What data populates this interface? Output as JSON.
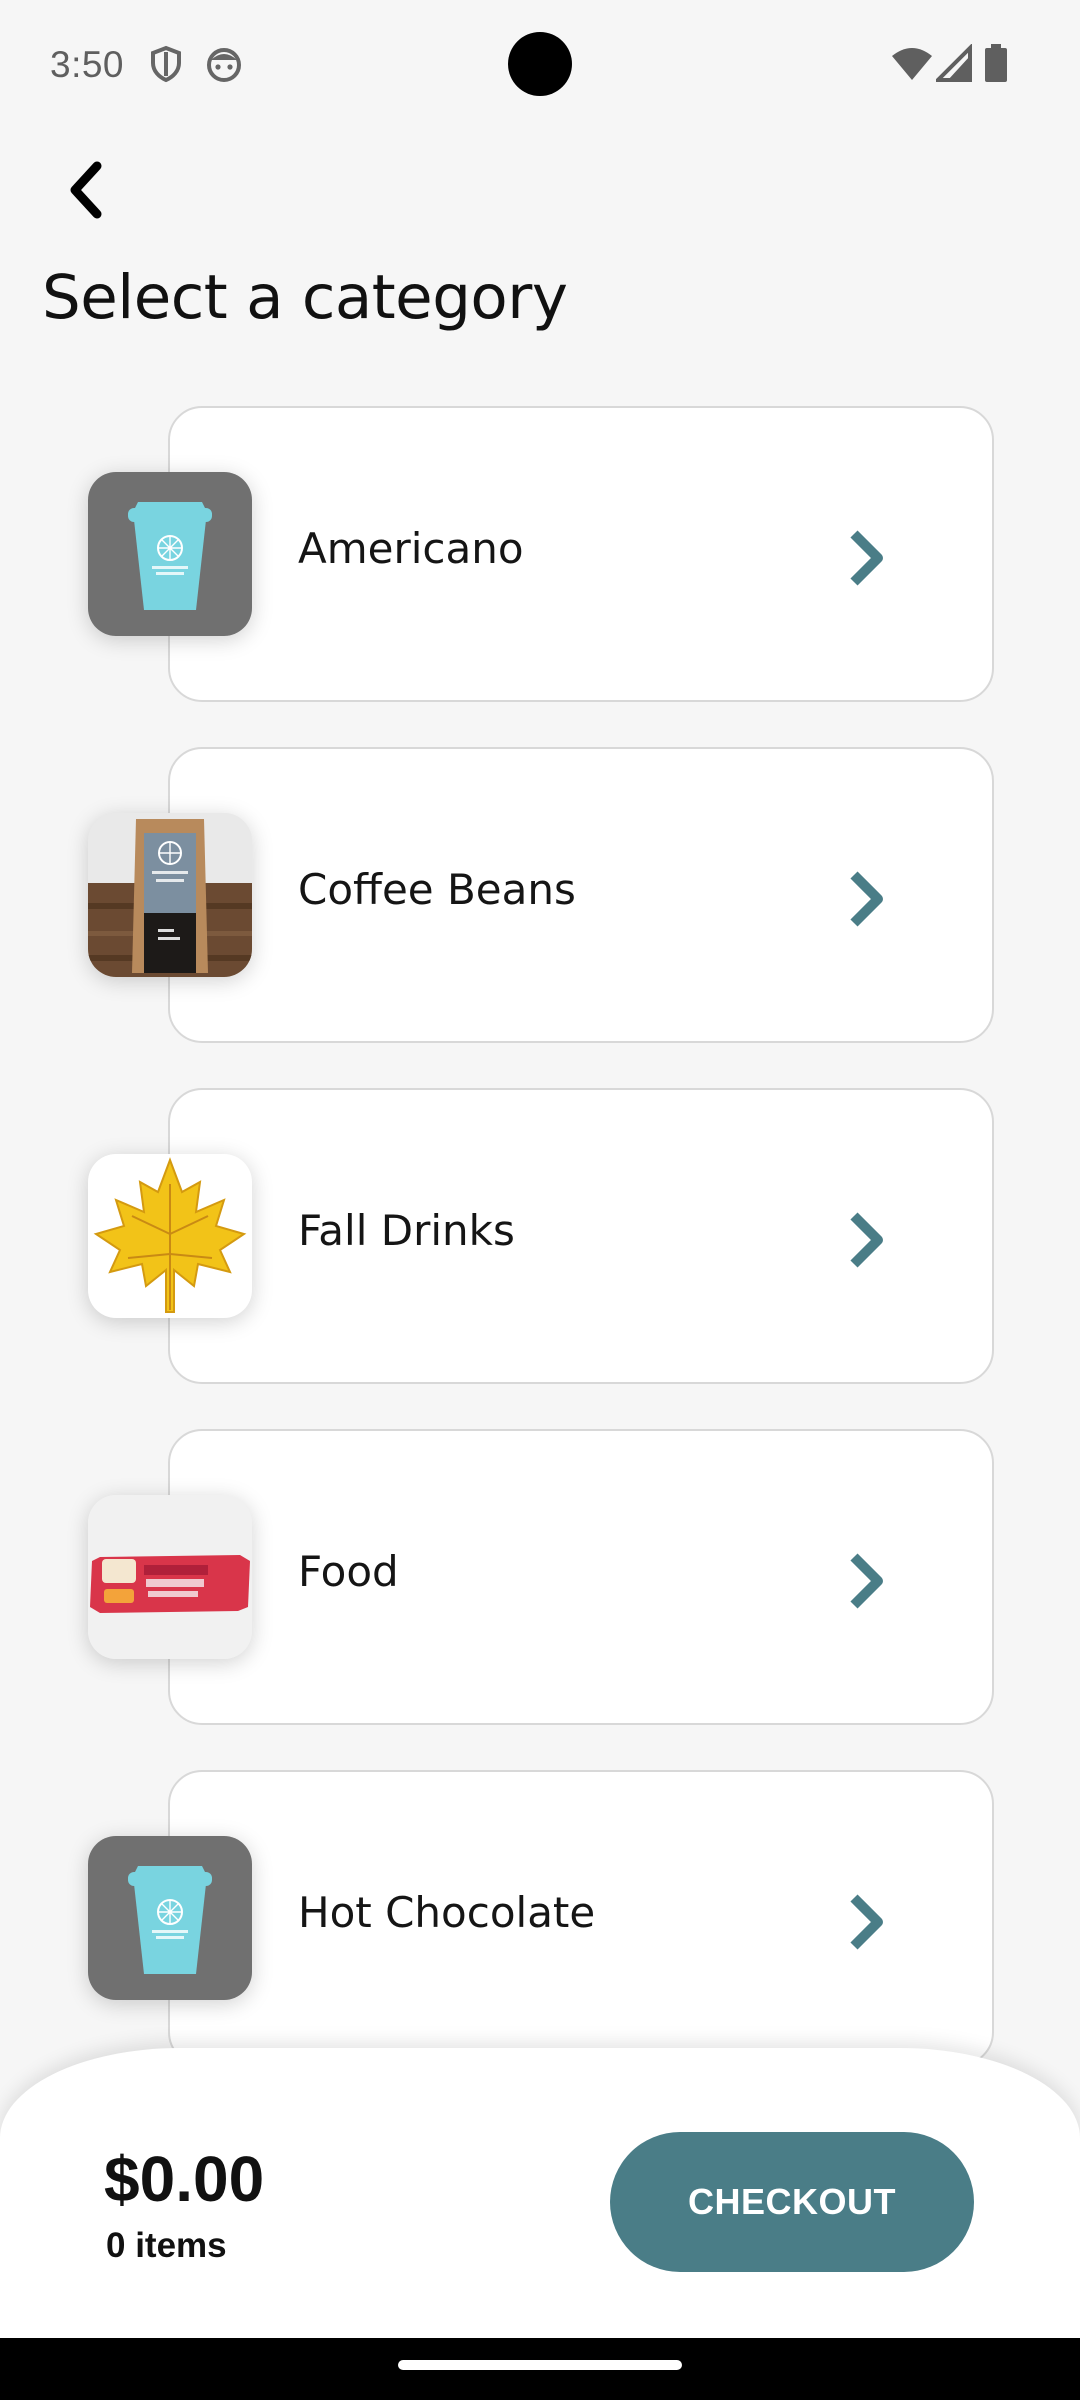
{
  "status_bar": {
    "time": "3:50"
  },
  "header": {
    "title": "Select a category"
  },
  "categories": [
    {
      "label": "Americano",
      "image": "coffee-cup"
    },
    {
      "label": "Coffee Beans",
      "image": "coffee-bag"
    },
    {
      "label": "Fall Drinks",
      "image": "maple-leaf"
    },
    {
      "label": "Food",
      "image": "snack-bar"
    },
    {
      "label": "Hot Chocolate",
      "image": "coffee-cup"
    }
  ],
  "cart": {
    "total": "$0.00",
    "items": "0 items",
    "checkout_label": "CHECKOUT"
  },
  "colors": {
    "accent": "#4a7d87",
    "chevron": "#4a7d87",
    "cup": "#79d4e0",
    "cup_bg": "#707070"
  }
}
